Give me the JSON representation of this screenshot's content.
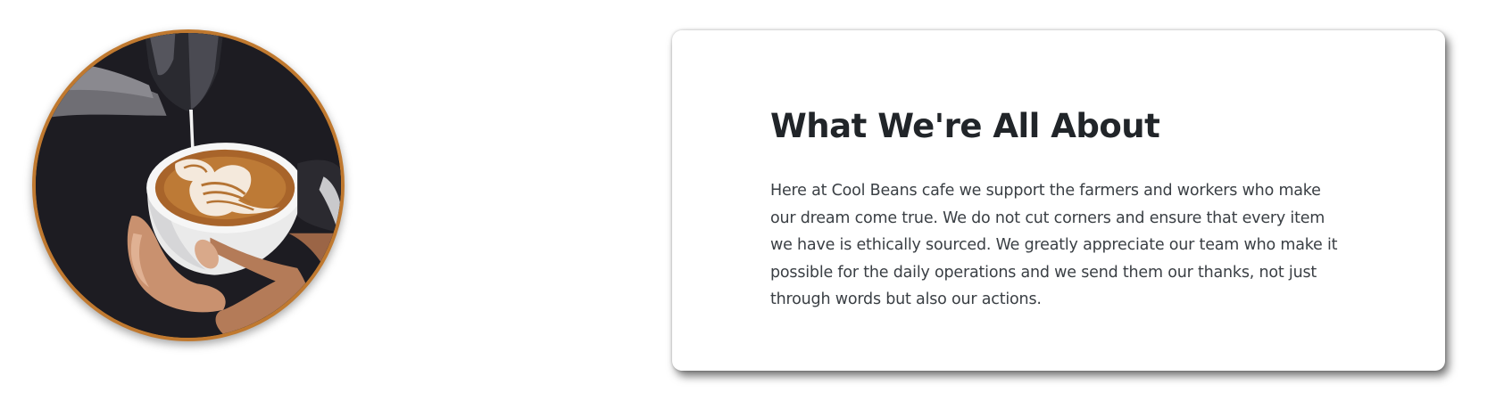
{
  "about": {
    "title": "What We're All About",
    "body": "Here at Cool Beans cafe we support the farmers and workers who make our dream come true. We do not cut corners and ensure that every item we have is ethically sourced. We greatly appreciate our team who make it possible for the daily operations and we send them our thanks, not just through words but also our actions."
  },
  "image": {
    "subject": "latte-art-pour",
    "border_color": "#c0792f"
  },
  "colors": {
    "heading": "#212529",
    "text": "#3a3f44",
    "card_bg": "#ffffff",
    "photo_border": "#c0792f"
  }
}
